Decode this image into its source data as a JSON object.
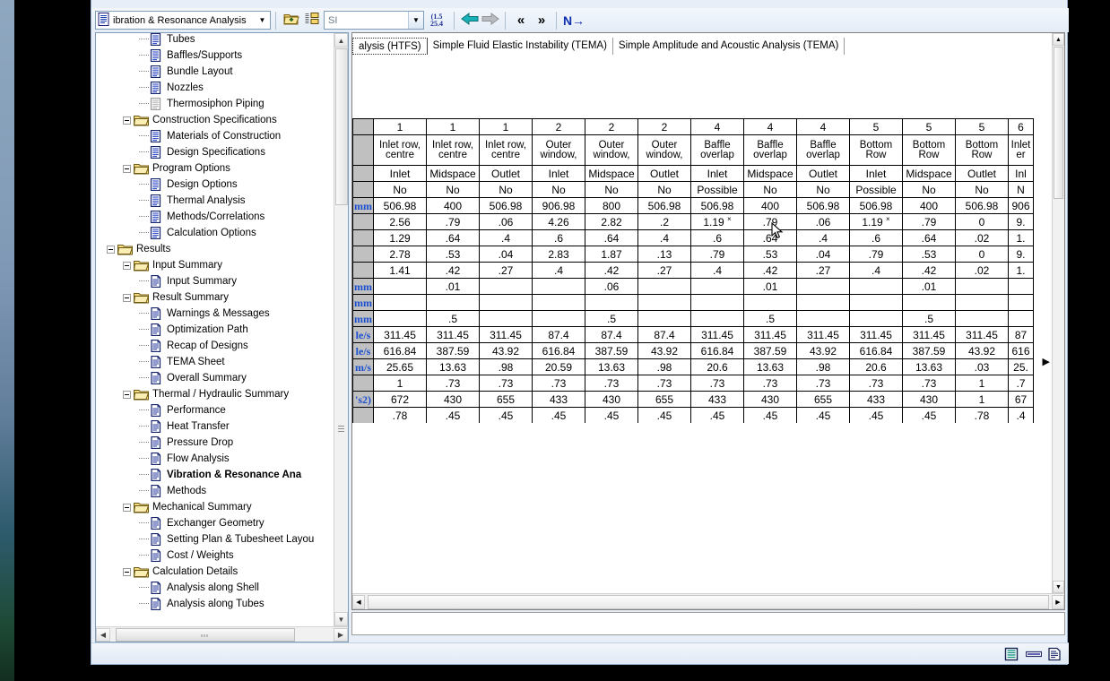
{
  "toolbar": {
    "document_selector": {
      "icon": "document-icon",
      "value": "ibration & Resonance Analysis",
      "arrow": "▼"
    },
    "open_folder_icon": "open-folder-up-icon",
    "list_view_icon": "list-view-icon",
    "units_select": {
      "value": "SI",
      "placeholder": "SI",
      "arrow": "▼"
    },
    "unit_convert_icon": "unit-conversion-icon",
    "unit_convert_top": "(1.5",
    "unit_convert_bottom": "25.4",
    "back_arrow": "⬅",
    "forward_arrow": "➡",
    "prev_chevron": "«",
    "next_chevron": "»",
    "next_item": "N→"
  },
  "window_buttons": {
    "minimize": "minimize-button",
    "maximize": "maximize-button",
    "close": "close-button"
  },
  "tree": {
    "items": [
      {
        "label": "Tubes",
        "depth": 3,
        "icon": "blue-page-icon",
        "expander": "none",
        "bold": false
      },
      {
        "label": "Baffles/Supports",
        "depth": 3,
        "icon": "blue-page-icon",
        "expander": "none",
        "bold": false
      },
      {
        "label": "Bundle Layout",
        "depth": 3,
        "icon": "blue-page-icon",
        "expander": "none",
        "bold": false
      },
      {
        "label": "Nozzles",
        "depth": 3,
        "icon": "blue-page-icon",
        "expander": "none",
        "bold": false
      },
      {
        "label": "Thermosiphon Piping",
        "depth": 3,
        "icon": "gray-page-icon",
        "expander": "none",
        "bold": false
      },
      {
        "label": "Construction Specifications",
        "depth": 2,
        "icon": "folder-icon",
        "expander": "minus",
        "bold": false
      },
      {
        "label": "Materials of Construction",
        "depth": 3,
        "icon": "blue-page-icon",
        "expander": "none",
        "bold": false
      },
      {
        "label": "Design Specifications",
        "depth": 3,
        "icon": "blue-page-icon",
        "expander": "none",
        "bold": false
      },
      {
        "label": "Program Options",
        "depth": 2,
        "icon": "folder-icon",
        "expander": "minus",
        "bold": false
      },
      {
        "label": "Design Options",
        "depth": 3,
        "icon": "blue-page-icon",
        "expander": "none",
        "bold": false
      },
      {
        "label": "Thermal Analysis",
        "depth": 3,
        "icon": "blue-page-icon",
        "expander": "none",
        "bold": false
      },
      {
        "label": "Methods/Correlations",
        "depth": 3,
        "icon": "blue-page-icon",
        "expander": "none",
        "bold": false
      },
      {
        "label": "Calculation Options",
        "depth": 3,
        "icon": "blue-page-icon",
        "expander": "none",
        "bold": false
      },
      {
        "label": "Results",
        "depth": 1,
        "icon": "folder-icon",
        "expander": "minus",
        "bold": false
      },
      {
        "label": "Input Summary",
        "depth": 2,
        "icon": "folder-icon",
        "expander": "minus",
        "bold": false
      },
      {
        "label": "Input Summary",
        "depth": 3,
        "icon": "white-page-icon",
        "expander": "none",
        "bold": false
      },
      {
        "label": "Result Summary",
        "depth": 2,
        "icon": "folder-icon",
        "expander": "minus",
        "bold": false
      },
      {
        "label": "Warnings & Messages",
        "depth": 3,
        "icon": "white-page-icon",
        "expander": "none",
        "bold": false
      },
      {
        "label": "Optimization Path",
        "depth": 3,
        "icon": "white-page-icon",
        "expander": "none",
        "bold": false
      },
      {
        "label": "Recap of Designs",
        "depth": 3,
        "icon": "white-page-icon",
        "expander": "none",
        "bold": false
      },
      {
        "label": "TEMA Sheet",
        "depth": 3,
        "icon": "white-page-icon",
        "expander": "none",
        "bold": false
      },
      {
        "label": "Overall Summary",
        "depth": 3,
        "icon": "white-page-icon",
        "expander": "none",
        "bold": false
      },
      {
        "label": "Thermal / Hydraulic Summary",
        "depth": 2,
        "icon": "folder-icon",
        "expander": "minus",
        "bold": false
      },
      {
        "label": "Performance",
        "depth": 3,
        "icon": "white-page-icon",
        "expander": "none",
        "bold": false
      },
      {
        "label": "Heat Transfer",
        "depth": 3,
        "icon": "white-page-icon",
        "expander": "none",
        "bold": false
      },
      {
        "label": "Pressure Drop",
        "depth": 3,
        "icon": "white-page-icon",
        "expander": "none",
        "bold": false
      },
      {
        "label": "Flow Analysis",
        "depth": 3,
        "icon": "white-page-icon",
        "expander": "none",
        "bold": false
      },
      {
        "label": "Vibration & Resonance Ana",
        "depth": 3,
        "icon": "white-page-icon",
        "expander": "none",
        "bold": true
      },
      {
        "label": "Methods",
        "depth": 3,
        "icon": "white-page-icon",
        "expander": "none",
        "bold": false
      },
      {
        "label": "Mechanical Summary",
        "depth": 2,
        "icon": "folder-icon",
        "expander": "minus",
        "bold": false
      },
      {
        "label": "Exchanger Geometry",
        "depth": 3,
        "icon": "white-page-icon",
        "expander": "none",
        "bold": false
      },
      {
        "label": "Setting Plan & Tubesheet Layou",
        "depth": 3,
        "icon": "white-page-icon",
        "expander": "none",
        "bold": false
      },
      {
        "label": "Cost / Weights",
        "depth": 3,
        "icon": "white-page-icon",
        "expander": "none",
        "bold": false
      },
      {
        "label": "Calculation Details",
        "depth": 2,
        "icon": "folder-icon",
        "expander": "minus",
        "bold": false
      },
      {
        "label": "Analysis along Shell",
        "depth": 3,
        "icon": "white-page-icon",
        "expander": "none",
        "bold": false
      },
      {
        "label": "Analysis along Tubes",
        "depth": 3,
        "icon": "white-page-icon",
        "expander": "none",
        "bold": false
      }
    ],
    "hscroll_grip": "⋯"
  },
  "tabs": [
    {
      "label": "alysis (HTFS)",
      "active": true
    },
    {
      "label": "Simple Fluid Elastic Instability (TEMA)",
      "active": false
    },
    {
      "label": "Simple Amplitude and Acoustic Analysis (TEMA)",
      "active": false
    }
  ],
  "grid": {
    "header_rows": [
      [
        "",
        "1",
        "1",
        "1",
        "2",
        "2",
        "2",
        "4",
        "4",
        "4",
        "5",
        "5",
        "5",
        "6"
      ],
      [
        "",
        "Inlet row,\ncentre",
        "Inlet row,\ncentre",
        "Inlet row,\ncentre",
        "Outer\nwindow,",
        "Outer\nwindow,",
        "Outer\nwindow,",
        "Baffle\noverlap",
        "Baffle\noverlap",
        "Baffle\noverlap",
        "Bottom\nRow",
        "Bottom\nRow",
        "Bottom\nRow",
        "Inlet\ner"
      ],
      [
        "",
        "Inlet",
        "Midspace",
        "Outlet",
        "Inlet",
        "Midspace",
        "Outlet",
        "Inlet",
        "Midspace",
        "Outlet",
        "Inlet",
        "Midspace",
        "Outlet",
        "Inl"
      ],
      [
        "",
        "No",
        "No",
        "No",
        "No",
        "No",
        "No",
        "Possible",
        "No",
        "No",
        "Possible",
        "No",
        "No",
        "N"
      ]
    ],
    "rows": [
      {
        "unit": "mm",
        "values": [
          "506.98",
          "400",
          "506.98",
          "906.98",
          "800",
          "506.98",
          "506.98",
          "400",
          "506.98",
          "506.98",
          "400",
          "506.98",
          "906"
        ]
      },
      {
        "unit": "",
        "values": [
          "2.56",
          ".79",
          ".06",
          "4.26",
          "2.82",
          ".2",
          "1.19 ×",
          ".79",
          ".06",
          "1.19 ×",
          ".79",
          "0",
          "9."
        ]
      },
      {
        "unit": "",
        "values": [
          "1.29",
          ".64",
          ".4",
          ".6",
          ".64",
          ".4",
          ".6",
          ".64",
          ".4",
          ".6",
          ".64",
          ".02",
          "1."
        ]
      },
      {
        "unit": "",
        "values": [
          "2.78",
          ".53",
          ".04",
          "2.83",
          "1.87",
          ".13",
          ".79",
          ".53",
          ".04",
          ".79",
          ".53",
          "0",
          "9."
        ]
      },
      {
        "unit": "",
        "values": [
          "1.41",
          ".42",
          ".27",
          ".4",
          ".42",
          ".27",
          ".4",
          ".42",
          ".27",
          ".4",
          ".42",
          ".02",
          "1."
        ]
      },
      {
        "unit": "mm",
        "values": [
          "",
          ".01",
          "",
          "",
          ".06",
          "",
          "",
          ".01",
          "",
          "",
          ".01",
          "",
          ""
        ]
      },
      {
        "unit": "mm",
        "values": [
          "",
          "",
          "",
          "",
          "",
          "",
          "",
          "",
          "",
          "",
          "",
          "",
          ""
        ]
      },
      {
        "unit": "mm",
        "values": [
          "",
          ".5",
          "",
          "",
          ".5",
          "",
          "",
          ".5",
          "",
          "",
          ".5",
          "",
          ""
        ]
      },
      {
        "unit": "le/s",
        "values": [
          "311.45",
          "311.45",
          "311.45",
          "87.4",
          "87.4",
          "87.4",
          "311.45",
          "311.45",
          "311.45",
          "311.45",
          "311.45",
          "311.45",
          "87"
        ]
      },
      {
        "unit": "le/s",
        "values": [
          "616.84",
          "387.59",
          "43.92",
          "616.84",
          "387.59",
          "43.92",
          "616.84",
          "387.59",
          "43.92",
          "616.84",
          "387.59",
          "43.92",
          "616"
        ]
      },
      {
        "unit": "m/s",
        "values": [
          "25.65",
          "13.63",
          ".98",
          "20.59",
          "13.63",
          ".98",
          "20.6",
          "13.63",
          ".98",
          "20.6",
          "13.63",
          ".03",
          "25."
        ]
      },
      {
        "unit": "",
        "values": [
          "1",
          ".73",
          ".73",
          ".73",
          ".73",
          ".73",
          ".73",
          ".73",
          ".73",
          ".73",
          ".73",
          "1",
          ".7"
        ]
      },
      {
        "unit": "'s2)",
        "values": [
          "672",
          "430",
          "655",
          "433",
          "430",
          "655",
          "433",
          "430",
          "655",
          "433",
          "430",
          "1",
          "67"
        ]
      },
      {
        "unit": "",
        "values": [
          ".78",
          ".45",
          ".45",
          ".45",
          ".45",
          ".45",
          ".45",
          ".45",
          ".45",
          ".45",
          ".45",
          ".78",
          ".4"
        ]
      }
    ]
  },
  "statusbar": {
    "icons": [
      "grid-view-icon",
      "list-view-icon",
      "report-view-icon"
    ]
  }
}
